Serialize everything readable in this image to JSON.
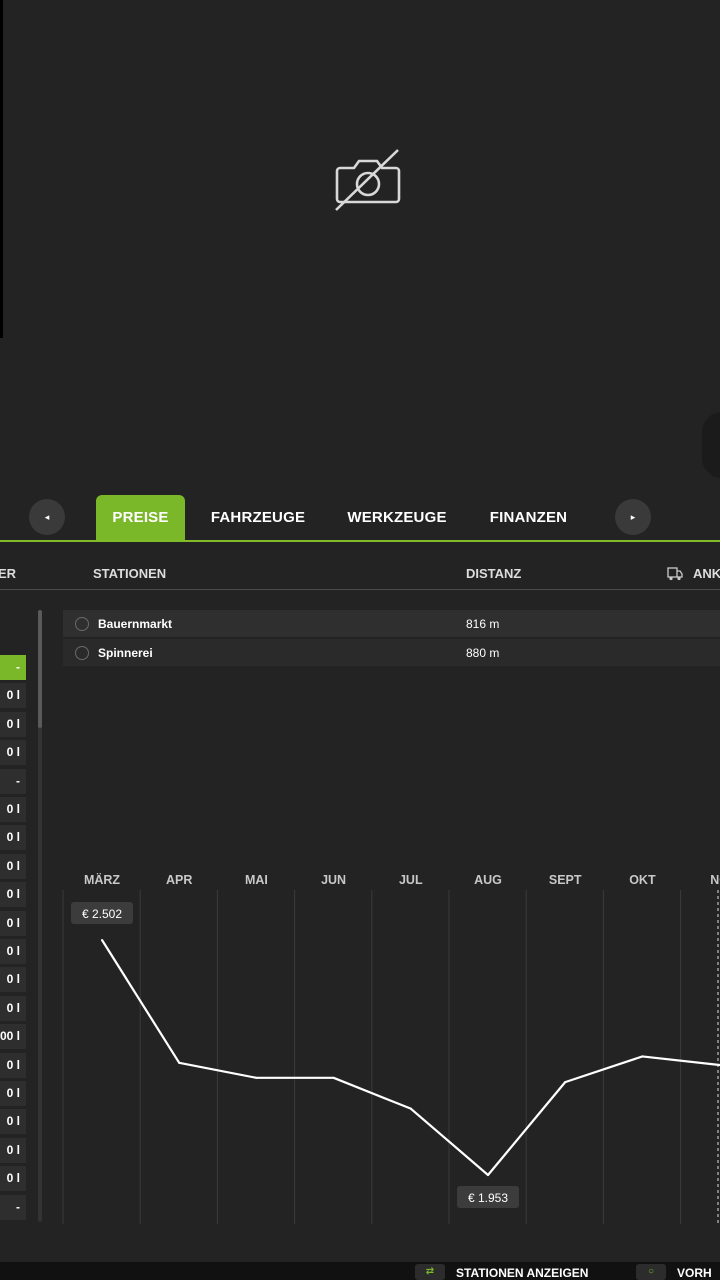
{
  "nav": {
    "prev_icon": "◂",
    "next_icon": "▸"
  },
  "tabs": [
    {
      "label": "PREISE",
      "active": true
    },
    {
      "label": "FAHRZEUGE",
      "active": false
    },
    {
      "label": "WERKZEUGE",
      "active": false
    },
    {
      "label": "FINANZEN",
      "active": false
    }
  ],
  "accent_color": "#7ab82a",
  "columns": {
    "left": "ER",
    "stations": "STATIONEN",
    "distance": "DISTANZ",
    "arrival": "ANK"
  },
  "left_list": [
    "-",
    "0 l",
    "0 l",
    "0 l",
    "-",
    "0 l",
    "0 l",
    "0 l",
    "0 l",
    "0 l",
    "0 l",
    "0 l",
    "0 l",
    "00 l",
    "0 l",
    "0 l",
    "0 l",
    "0 l",
    "0 l",
    "-"
  ],
  "stations": [
    {
      "name": "Bauernmarkt",
      "distance": "816 m"
    },
    {
      "name": "Spinnerei",
      "distance": "880 m"
    }
  ],
  "chart_data": {
    "type": "line",
    "categories": [
      "MÄRZ",
      "APR",
      "MAI",
      "JUN",
      "JUL",
      "AUG",
      "SEPT",
      "OKT",
      "NO"
    ],
    "values": [
      2502,
      2215,
      2180,
      2180,
      2108,
      1953,
      2170,
      2230,
      2210
    ],
    "max_label": "€ 2.502",
    "min_label": "€ 1.953"
  },
  "bottom_bar": {
    "show_stations": {
      "key": "⇄",
      "label": "STATIONEN ANZEIGEN"
    },
    "available": {
      "key": "○",
      "label": "VORH"
    }
  }
}
